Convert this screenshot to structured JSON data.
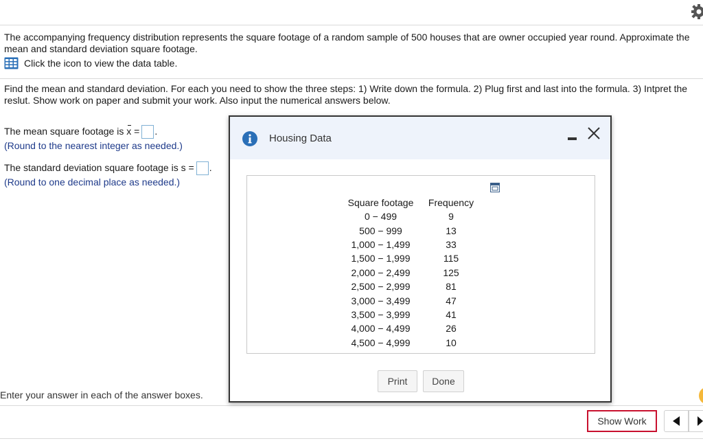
{
  "problem": {
    "text": "The accompanying frequency distribution represents the square footage of a random sample of 500 houses that are owner occupied year round. Approximate the mean and standard deviation square footage.",
    "table_link_label": "Click the icon to view the data table."
  },
  "instructions": "Find the mean and standard deviation.  For each you need to show the three steps: 1) Write down the formula. 2) Plug first and last into the formula. 3) Intpret the reslut.  Show work on paper and submit your work.  Also input the numerical answers below.",
  "questions": {
    "mean": {
      "prefix": "The mean square footage is ",
      "symbol": "x",
      "equals": " =",
      "suffix": ".",
      "hint": "(Round to the nearest integer as needed.)",
      "value": ""
    },
    "sd": {
      "prefix": "The standard deviation square footage is s =",
      "suffix": ".",
      "hint": "(Round to one decimal place as needed.)",
      "value": ""
    }
  },
  "footer": {
    "hint": "Enter your answer in each of the answer boxes.",
    "show_work_label": "Show Work"
  },
  "dialog": {
    "title": "Housing Data",
    "print_label": "Print",
    "done_label": "Done",
    "columns": [
      "Square footage",
      "Frequency"
    ],
    "rows": [
      [
        "0 − 499",
        "9"
      ],
      [
        "500 − 999",
        "13"
      ],
      [
        "1,000 − 1,499",
        "33"
      ],
      [
        "1,500 − 1,999",
        "115"
      ],
      [
        "2,000 − 2,499",
        "125"
      ],
      [
        "2,500 − 2,999",
        "81"
      ],
      [
        "3,000 − 3,499",
        "47"
      ],
      [
        "3,500 − 3,999",
        "41"
      ],
      [
        "4,000 − 4,499",
        "26"
      ],
      [
        "4,500 − 4,999",
        "10"
      ]
    ]
  },
  "icons": {
    "gear": "gear-icon",
    "table": "data-table-icon",
    "info": "info-icon",
    "minimize": "minimize-icon",
    "close": "close-icon",
    "copy": "copy-table-icon",
    "prev": "triangle-left-icon",
    "next": "triangle-right-icon"
  },
  "colors": {
    "accent_blue": "#2a6fb7",
    "hint_text": "#1e3a8a",
    "show_work_border": "#c8102e",
    "dialog_header_bg": "#eef3fb"
  }
}
